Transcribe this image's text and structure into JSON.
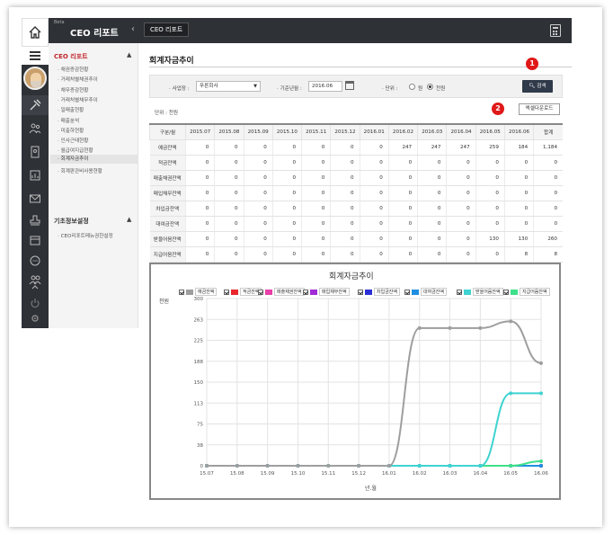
{
  "app": {
    "beta": "Beta",
    "title": "CEO 리포트",
    "tab": "CEO 리포트"
  },
  "sidebar": {
    "section1_title": "CEO 리포트",
    "items": [
      "채권증감현황",
      "거래처별채권추이",
      "채무증감현황",
      "거래처별채무추이",
      "일매출현황",
      "매출분석",
      "미출하현황",
      "인사근태현황",
      "월급여지급현황",
      "회계자금추이",
      "회계판관비사용현황"
    ],
    "active_index": 9,
    "section2_title": "기초정보설정",
    "section2_items": [
      "CEO리포트메뉴권한설정"
    ]
  },
  "page": {
    "title": "회계자금추이"
  },
  "filters": {
    "company_label": "사업장",
    "company_value": "푸른회사",
    "date_label": "기준년월",
    "date_value": "2016.06",
    "unit_label": "단위",
    "unit_options": [
      "원",
      "천원"
    ],
    "unit_selected": "천원",
    "search_label": "검색",
    "excel_label": "엑셀다운로드"
  },
  "badges": [
    "1",
    "2"
  ],
  "unit_note": "단위 : 천원",
  "table": {
    "corner": "구분/월",
    "months": [
      "2015.07",
      "2015.08",
      "2015.09",
      "2015.10",
      "2015.11",
      "2015.12",
      "2016.01",
      "2016.02",
      "2016.03",
      "2016.04",
      "2016.05",
      "2016.06",
      "합계"
    ],
    "rows": [
      {
        "label": "예금잔액",
        "values": [
          "0",
          "0",
          "0",
          "0",
          "0",
          "0",
          "0",
          "247",
          "247",
          "247",
          "259",
          "184",
          "1,184"
        ]
      },
      {
        "label": "적금잔액",
        "values": [
          "0",
          "0",
          "0",
          "0",
          "0",
          "0",
          "0",
          "0",
          "0",
          "0",
          "0",
          "0",
          "0"
        ]
      },
      {
        "label": "매출채권잔액",
        "values": [
          "0",
          "0",
          "0",
          "0",
          "0",
          "0",
          "0",
          "0",
          "0",
          "0",
          "0",
          "0",
          "0"
        ]
      },
      {
        "label": "매입채무잔액",
        "values": [
          "0",
          "0",
          "0",
          "0",
          "0",
          "0",
          "0",
          "0",
          "0",
          "0",
          "0",
          "0",
          "0"
        ]
      },
      {
        "label": "차입금잔액",
        "values": [
          "0",
          "0",
          "0",
          "0",
          "0",
          "0",
          "0",
          "0",
          "0",
          "0",
          "0",
          "0",
          "0"
        ]
      },
      {
        "label": "대여금잔액",
        "values": [
          "0",
          "0",
          "0",
          "0",
          "0",
          "0",
          "0",
          "0",
          "0",
          "0",
          "0",
          "0",
          "0"
        ]
      },
      {
        "label": "받을어음잔액",
        "values": [
          "0",
          "0",
          "0",
          "0",
          "0",
          "0",
          "0",
          "0",
          "0",
          "0",
          "130",
          "130",
          "260"
        ]
      },
      {
        "label": "지급어음잔액",
        "values": [
          "0",
          "0",
          "0",
          "0",
          "0",
          "0",
          "0",
          "0",
          "0",
          "0",
          "0",
          "8",
          "8"
        ]
      }
    ]
  },
  "chart_data": {
    "type": "line",
    "title": "회계자금추이",
    "ylabel": "천원",
    "xlabel": "년.월",
    "x": [
      "15.07",
      "15.08",
      "15.09",
      "15.10",
      "15.11",
      "15.12",
      "16.01",
      "16.02",
      "16.03",
      "16.04",
      "16.05",
      "16.06"
    ],
    "ylim": [
      0,
      300
    ],
    "yticks": [
      "0",
      "38",
      "75",
      "113",
      "150",
      "188",
      "225",
      "263",
      "300"
    ],
    "series": [
      {
        "name": "예금잔액",
        "color": "#9e9e9e",
        "values": [
          0,
          0,
          0,
          0,
          0,
          0,
          0,
          247,
          247,
          247,
          259,
          184
        ]
      },
      {
        "name": "적금잔액",
        "color": "#e8262b",
        "values": [
          0,
          0,
          0,
          0,
          0,
          0,
          0,
          0,
          0,
          0,
          0,
          0
        ]
      },
      {
        "name": "매출채권잔액",
        "color": "#e83ea8",
        "values": [
          0,
          0,
          0,
          0,
          0,
          0,
          0,
          0,
          0,
          0,
          0,
          0
        ]
      },
      {
        "name": "매입채무잔액",
        "color": "#a12bd6",
        "values": [
          0,
          0,
          0,
          0,
          0,
          0,
          0,
          0,
          0,
          0,
          0,
          0
        ]
      },
      {
        "name": "차입금잔액",
        "color": "#2b2fd6",
        "values": [
          0,
          0,
          0,
          0,
          0,
          0,
          0,
          0,
          0,
          0,
          0,
          0
        ]
      },
      {
        "name": "대여금잔액",
        "color": "#1f8fe0",
        "values": [
          0,
          0,
          0,
          0,
          0,
          0,
          0,
          0,
          0,
          0,
          0,
          0
        ]
      },
      {
        "name": "받을어음잔액",
        "color": "#3ed3d0",
        "values": [
          0,
          0,
          0,
          0,
          0,
          0,
          0,
          0,
          0,
          0,
          130,
          130
        ]
      },
      {
        "name": "지급어음잔액",
        "color": "#3ee08a",
        "values": [
          0,
          0,
          0,
          0,
          0,
          0,
          0,
          0,
          0,
          0,
          0,
          8
        ]
      }
    ]
  }
}
